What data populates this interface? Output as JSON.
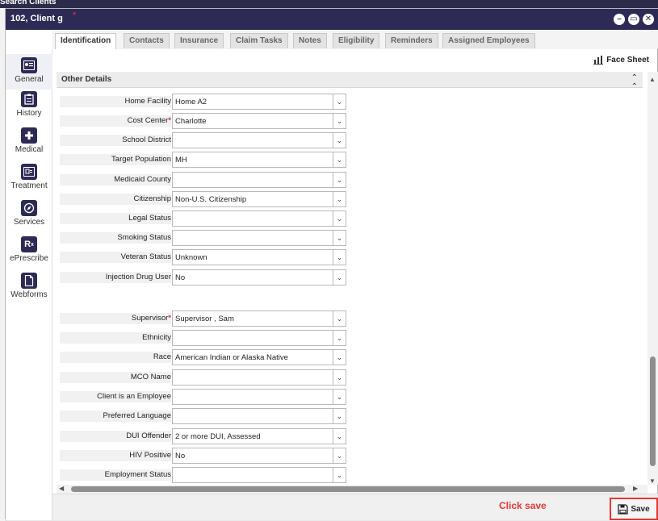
{
  "background": {
    "top_label": "Search Clients"
  },
  "window": {
    "title": "102, Client g",
    "title_marker": "*"
  },
  "tabs": [
    {
      "label": "Identification"
    },
    {
      "label": "Contacts"
    },
    {
      "label": "Insurance"
    },
    {
      "label": "Claim Tasks"
    },
    {
      "label": "Notes"
    },
    {
      "label": "Eligibility"
    },
    {
      "label": "Reminders"
    },
    {
      "label": "Assigned Employees"
    }
  ],
  "sidebar": {
    "items": [
      {
        "label": "General",
        "icon": "id-card-icon"
      },
      {
        "label": "History",
        "icon": "clipboard-icon"
      },
      {
        "label": "Medical",
        "icon": "plus-icon"
      },
      {
        "label": "Treatment",
        "icon": "treatment-icon"
      },
      {
        "label": "Services",
        "icon": "compass-icon"
      },
      {
        "label": "ePrescribe",
        "icon": "rx-icon"
      },
      {
        "label": "Webforms",
        "icon": "document-icon"
      }
    ]
  },
  "toolbar": {
    "face_sheet_label": "Face Sheet"
  },
  "section": {
    "title": "Other Details"
  },
  "fields": [
    {
      "label": "Home Facility",
      "value": "Home A2",
      "required": ""
    },
    {
      "label": "Cost Center",
      "value": "Charlotte",
      "required": "*"
    },
    {
      "label": "School District",
      "value": "",
      "required": ""
    },
    {
      "label": "Target Population",
      "value": "MH",
      "required": ""
    },
    {
      "label": "Medicaid County",
      "value": "",
      "required": ""
    },
    {
      "label": "Citizenship",
      "value": "Non-U.S. Citizenship",
      "required": ""
    },
    {
      "label": "Legal Status",
      "value": "",
      "required": ""
    },
    {
      "label": "Smoking Status",
      "value": "",
      "required": ""
    },
    {
      "label": "Veteran Status",
      "value": "Unknown",
      "required": ""
    },
    {
      "label": "Injection Drug User",
      "value": "No",
      "required": ""
    },
    {
      "label": "Supervisor",
      "value": "Supervisor , Sam",
      "required": "*"
    },
    {
      "label": "Ethnicity",
      "value": "",
      "required": ""
    },
    {
      "label": "Race",
      "value": "American Indian or Alaska Native",
      "required": ""
    },
    {
      "label": "MCO Name",
      "value": "",
      "required": ""
    },
    {
      "label": "Client is an Employee",
      "value": "",
      "required": ""
    },
    {
      "label": "Preferred Language",
      "value": "",
      "required": ""
    },
    {
      "label": "DUI Offender",
      "value": "2 or more DUI, Assessed",
      "required": ""
    },
    {
      "label": "HIV Positive",
      "value": "No",
      "required": ""
    },
    {
      "label": "Employment Status",
      "value": "",
      "required": ""
    }
  ],
  "footer": {
    "annotation": "Click save",
    "save_label": "Save"
  },
  "colors": {
    "title_bar": "#2d2b55",
    "required_marker": "#d32f2f",
    "annotation": "#e53935"
  }
}
